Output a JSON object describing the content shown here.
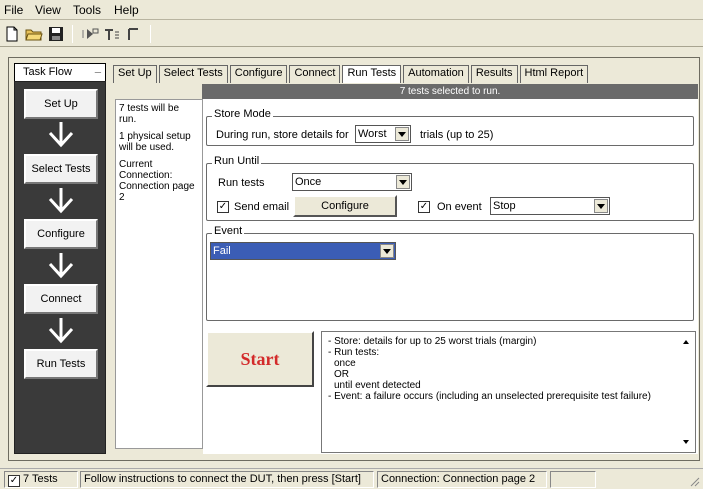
{
  "menu": [
    "File",
    "View",
    "Tools",
    "Help"
  ],
  "toolbar": {
    "icons": [
      "new-file-icon",
      "open-folder-icon",
      "save-icon",
      "run-icon",
      "step-icon",
      "stop-icon"
    ]
  },
  "task_flow": {
    "title": "Task Flow",
    "collapse": "_",
    "steps": [
      "Set Up",
      "Select Tests",
      "Configure",
      "Connect",
      "Run Tests"
    ]
  },
  "tabs": [
    "Set Up",
    "Select Tests",
    "Configure",
    "Connect",
    "Run Tests",
    "Automation",
    "Results",
    "Html Report"
  ],
  "active_tab": "Run Tests",
  "header": "7 tests selected to run.",
  "summary": {
    "line1": "7 tests will be run.",
    "line2": "1 physical setup will be used.",
    "line3": "Current Connection: Connection page 2"
  },
  "store_mode": {
    "label": "Store Mode",
    "prefix": "During run, store details for",
    "value": "Worst",
    "suffix": "trials (up to 25)"
  },
  "run_until": {
    "label": "Run Until",
    "run_tests_label": "Run tests",
    "run_tests_value": "Once",
    "send_email_label": "Send email",
    "send_email_checked": true,
    "configure_label": "Configure",
    "on_event_label": "On event",
    "on_event_checked": true,
    "on_event_value": "Stop"
  },
  "event": {
    "label": "Event",
    "value": "Fail"
  },
  "start_label": "Start",
  "description": [
    "- Store: details for up to 25 worst trials (margin)",
    "- Run tests:",
    "once",
    "OR",
    "until event detected",
    "- Event: a failure occurs (including an unselected prerequisite test failure)"
  ],
  "statusbar": {
    "tests": "7 Tests",
    "tests_checked": true,
    "message": "Follow instructions to connect the DUT, then press [Start]",
    "connection": "Connection: Connection page 2"
  },
  "colors": {
    "header_bg": "#6a6a6a",
    "sidebar_bg": "#3a3a3a",
    "start_text": "#d32a2a",
    "event_selected": "#3b5db5"
  }
}
